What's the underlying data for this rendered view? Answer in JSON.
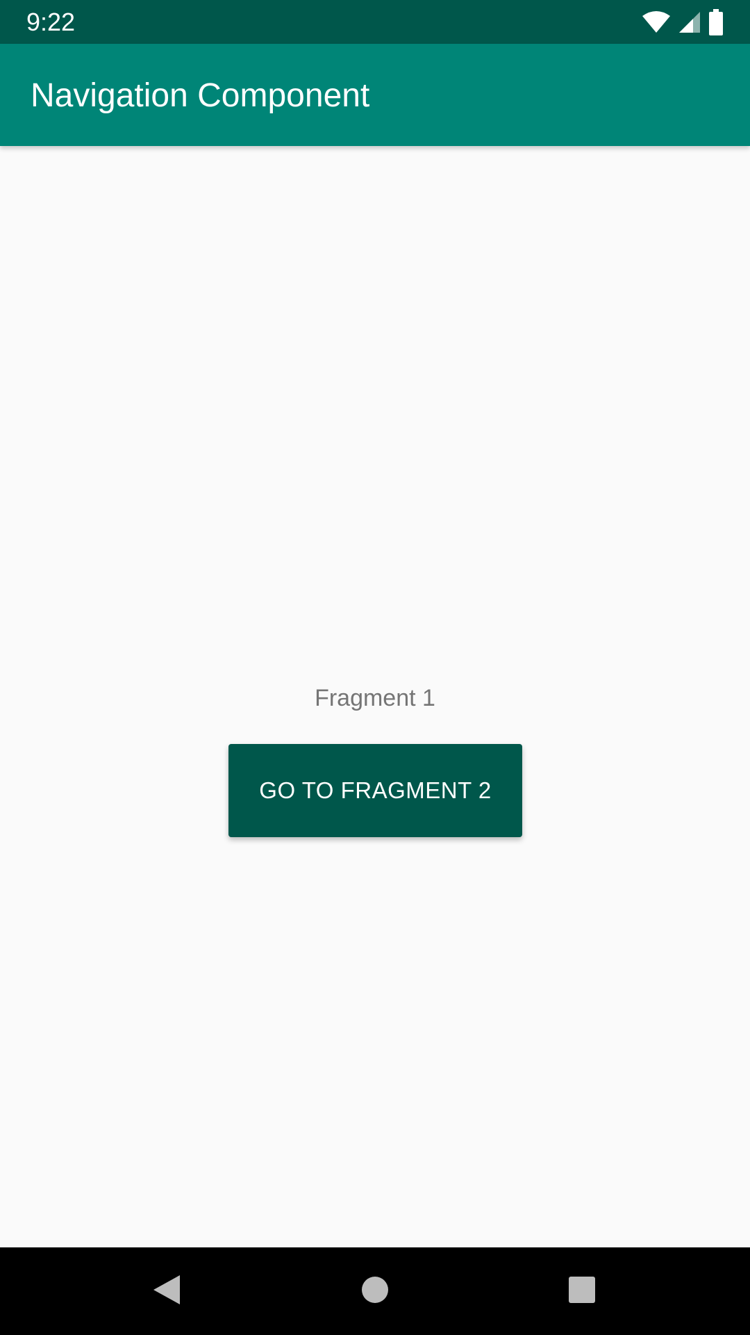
{
  "status_bar": {
    "time": "9:22",
    "icons": [
      "wifi-icon",
      "signal-icon",
      "battery-icon"
    ]
  },
  "app_bar": {
    "title": "Navigation Component"
  },
  "content": {
    "label": "Fragment 1",
    "button_label": "GO TO FRAGMENT 2"
  },
  "nav_bar": {
    "buttons": [
      "back-icon",
      "home-icon",
      "recents-icon"
    ]
  },
  "colors": {
    "status_bar": "#00574b",
    "app_bar": "#008577",
    "button": "#00574b",
    "background": "#fafafa"
  }
}
